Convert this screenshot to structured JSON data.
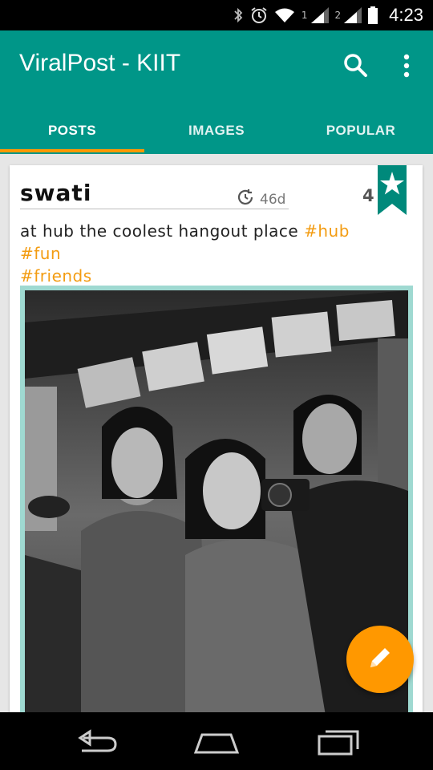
{
  "status_bar": {
    "time": "4:23",
    "sim1_label": "1",
    "sim2_label": "2",
    "icons": [
      "bluetooth-icon",
      "alarm-icon",
      "wifi-icon",
      "signal-icon",
      "signal-icon",
      "battery-icon"
    ]
  },
  "app_bar": {
    "title": "ViralPost - KIIT",
    "search_icon": "search-icon",
    "more_icon": "more-vert-icon",
    "color": "#009688"
  },
  "tabs": [
    {
      "label": "POSTS",
      "active": true
    },
    {
      "label": "IMAGES",
      "active": false
    },
    {
      "label": "POPULAR",
      "active": false
    }
  ],
  "accent_color": "#ff9800",
  "post": {
    "author": "swati",
    "age": "46d",
    "likes": "4",
    "text_prefix": "at hub the coolest hangout place",
    "tags": [
      "#hub",
      "#fun",
      "#friends"
    ],
    "bookmark_icon": "star-bookmark-icon",
    "image_alt": "grayscale photo of three friends posing"
  },
  "fab": {
    "icon": "pencil-icon"
  },
  "nav_bar": {
    "icons": [
      "back-icon",
      "home-icon",
      "recents-icon"
    ]
  }
}
